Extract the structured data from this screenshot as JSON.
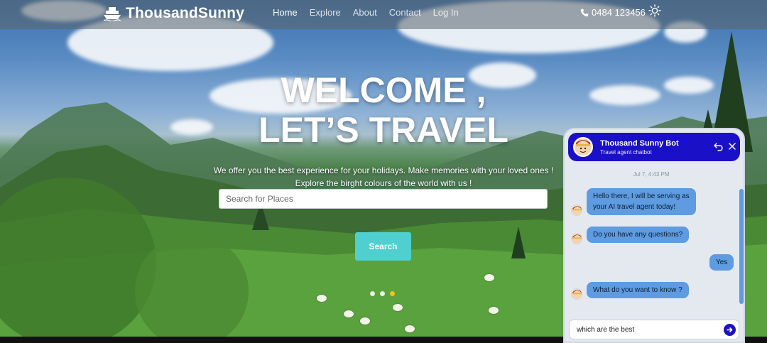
{
  "nav": {
    "brand": "ThousandSunny",
    "links": [
      {
        "label": "Home",
        "active": true
      },
      {
        "label": "Explore",
        "active": false
      },
      {
        "label": "About",
        "active": false
      },
      {
        "label": "Contact",
        "active": false
      },
      {
        "label": "Log In",
        "active": false
      }
    ],
    "phone": "0484 123456"
  },
  "hero": {
    "headline_1": "WELCOME ,",
    "headline_2": "LET’S TRAVEL",
    "sub_1": "We offer you the best experience for your holidays. Make memories with your loved ones !",
    "sub_2": "Explore the birght colours of the world with us !",
    "search_placeholder": "Search for Places",
    "search_button": "Search",
    "slides": 3,
    "active_slide": 3
  },
  "chat": {
    "bot_name": "Thousand Sunny Bot",
    "bot_role": "Travel agent chatbot",
    "timestamp": "Jul 7, 4:43 PM",
    "messages": [
      {
        "from": "bot",
        "lines": [
          "Hello there, I will be serving as",
          "your AI travel agent today!"
        ]
      },
      {
        "from": "bot",
        "lines": [
          "Do you have any questions?"
        ]
      },
      {
        "from": "user",
        "lines": [
          "Yes"
        ]
      },
      {
        "from": "bot",
        "lines": [
          "What do you want to know ?"
        ]
      }
    ],
    "input_value": "which are the best"
  },
  "colors": {
    "accent_teal": "#4fcfd0",
    "chat_header": "#1a10c8",
    "bubble": "#5e9be0",
    "slide_active": "#f0c419"
  },
  "icons": {
    "brand": "ship-icon",
    "phone": "phone-icon",
    "theme": "sun-icon",
    "chat_back": "undo-icon",
    "chat_close": "close-icon",
    "send": "send-arrow-icon"
  }
}
